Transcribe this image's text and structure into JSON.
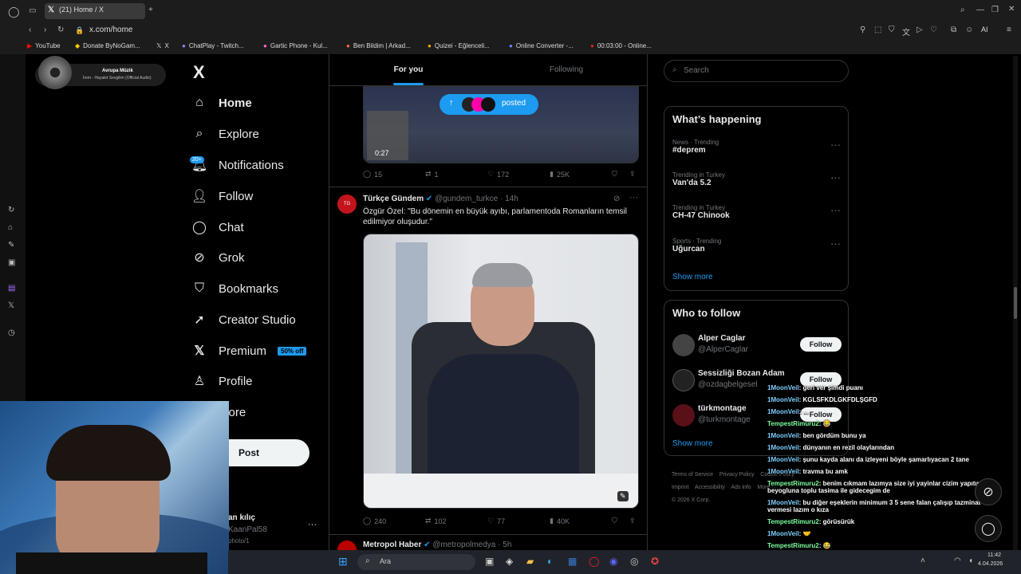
{
  "browser": {
    "tab_title": "(21) Home / X",
    "url": "x.com/home",
    "bookmarks": [
      "YouTube",
      "Donate ByNoGam...",
      "X",
      "ChatPlay - Twitch...",
      "Gartic Phone - Kul...",
      "Ben Bildim | Arkad...",
      "Quizei - Eğlenceli...",
      "Online Converter -...",
      "00:03:00 - Online..."
    ],
    "ai_label": "AI"
  },
  "music": {
    "title": "Avrupa Müzik",
    "subtitle": "İrem - Hayalet Sevgilim (Official Audio)"
  },
  "nav": {
    "logo": "X",
    "items": [
      "Home",
      "Explore",
      "Notifications",
      "Follow",
      "Chat",
      "Grok",
      "Bookmarks",
      "Creator Studio",
      "Premium",
      "Profile",
      "More"
    ],
    "notif_badge": "20+",
    "premium_tag": "50% off",
    "post_label": "Post",
    "account_name": "an kılıç",
    "account_handle": "KaanPal58",
    "account_extra": "photo/1",
    "more_dots": "···"
  },
  "feed": {
    "tabs": [
      "For you",
      "Following"
    ],
    "posted_pill": "posted",
    "video_time": "0:27",
    "post1_actions": {
      "replies": "15",
      "reposts": "1",
      "likes": "172",
      "views": "25K"
    },
    "post2": {
      "author": "Türkçe Gündem",
      "handle": "@gundem_turkce",
      "time": "14h",
      "text": "Özgür Özel: \"Bu dönemin en büyük ayıbı, parlamentoda Romanların temsil edilmiyor oluşudur.\"",
      "actions": {
        "replies": "240",
        "reposts": "102",
        "likes": "77",
        "views": "40K"
      }
    },
    "post3": {
      "author": "Metropol Haber",
      "handle": "@metropolmedya",
      "time": "5h"
    }
  },
  "right": {
    "search_placeholder": "Search",
    "happening_title": "What’s happening",
    "trends": [
      {
        "meta": "News · Trending",
        "name": "#deprem"
      },
      {
        "meta": "Trending in Turkey",
        "name": "Van'da 5.2"
      },
      {
        "meta": "Trending in Turkey",
        "name": "CH-47 Chinook"
      },
      {
        "meta": "Sports · Trending",
        "name": "Uğurcan"
      }
    ],
    "show_more": "Show more",
    "who_title": "Who to follow",
    "who": [
      {
        "name": "Alper Caglar",
        "handle": "@AlperCaglar"
      },
      {
        "name": "Sessizliği Bozan Adam",
        "handle": "@ozdagbelgesel"
      },
      {
        "name": "türkmontage",
        "handle": "@turkmontage"
      }
    ],
    "follow_label": "Follow",
    "footer": [
      "Terms of Service",
      "Privacy Policy",
      "Cookie Policy",
      "Imprint",
      "Accessibility",
      "Ads info",
      "More ···",
      "© 2026 X Corp."
    ]
  },
  "chat": [
    {
      "user": "1MoonVeil",
      "msg": ": geri ver şimdi puanı"
    },
    {
      "user": "1MoonVeil",
      "msg": ": KGLSFKDLGKFDLŞGFD"
    },
    {
      "user": "1MoonVeil",
      "msg": ": ..."
    },
    {
      "user": "TempestRimuru2",
      "msg": ": 😂"
    },
    {
      "user": "1MoonVeil",
      "msg": ": ben gördüm bunu ya"
    },
    {
      "user": "1MoonVeil",
      "msg": ": dünyanın en rezil olaylarından"
    },
    {
      "user": "1MoonVeil",
      "msg": ": şunu kayda alanı da izleyeni böyle şamarlıyacan 2 tane"
    },
    {
      "user": "1MoonVeil",
      "msg": ": travma bu amk"
    },
    {
      "user": "TempestRimuru2",
      "msg": ": benim cıkmam lazımya size iyi yayinlar cizim yapıtın beyogluna toplu tasima ile gidecegim de"
    },
    {
      "user": "1MoonVeil",
      "msg": ": bu diğer eşeklerin minimum 3 5 sene falan çalışıp tazminat vermesi lazım o kıza"
    },
    {
      "user": "TempestRimuru2",
      "msg": ": görüsürük"
    },
    {
      "user": "1MoonVeil",
      "msg": ": 🤝"
    },
    {
      "user": "TempestRimuru2",
      "msg": ": 😂"
    }
  ],
  "taskbar": {
    "search": "Ara",
    "time": "11:42",
    "date": "4.04.2026"
  },
  "colors": {
    "accent": "#1d9bf0",
    "background": "#000000",
    "border": "#2f3336",
    "muted": "#71767b"
  }
}
